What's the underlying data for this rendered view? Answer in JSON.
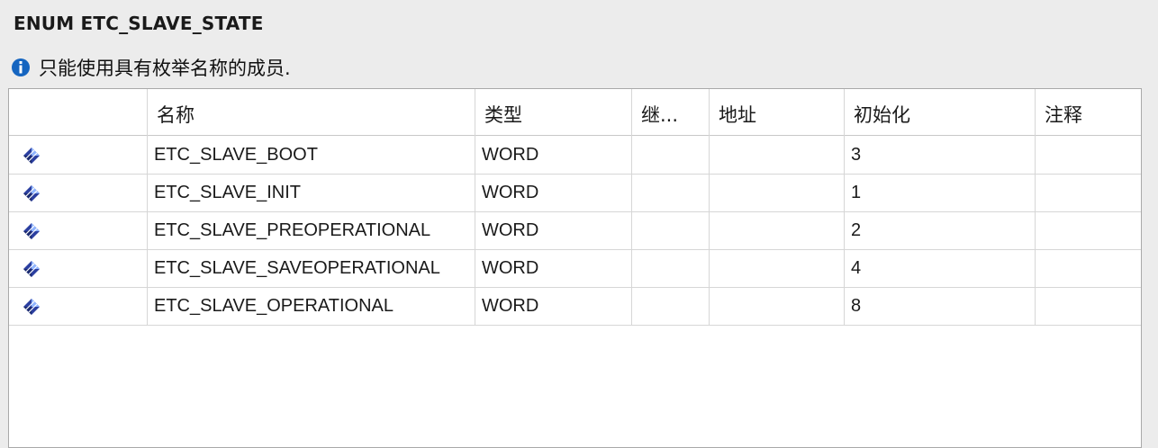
{
  "title": "ENUM  ETC_SLAVE_STATE",
  "info": {
    "icon": "info-icon",
    "text": "只能使用具有枚举名称的成员."
  },
  "table": {
    "columns": [
      "",
      "名称",
      "类型",
      "继...",
      "地址",
      "初始化",
      "注释"
    ],
    "rows": [
      {
        "icon": "enum-member-icon",
        "name": "ETC_SLAVE_BOOT",
        "type": "WORD",
        "inherit": "",
        "address": "",
        "init": "3",
        "comment": ""
      },
      {
        "icon": "enum-member-icon",
        "name": "ETC_SLAVE_INIT",
        "type": "WORD",
        "inherit": "",
        "address": "",
        "init": "1",
        "comment": ""
      },
      {
        "icon": "enum-member-icon",
        "name": "ETC_SLAVE_PREOPERATIONAL",
        "type": "WORD",
        "inherit": "",
        "address": "",
        "init": "2",
        "comment": ""
      },
      {
        "icon": "enum-member-icon",
        "name": "ETC_SLAVE_SAVEOPERATIONAL",
        "type": "WORD",
        "inherit": "",
        "address": "",
        "init": "4",
        "comment": ""
      },
      {
        "icon": "enum-member-icon",
        "name": "ETC_SLAVE_OPERATIONAL",
        "type": "WORD",
        "inherit": "",
        "address": "",
        "init": "8",
        "comment": ""
      }
    ]
  },
  "colors": {
    "background": "#ececec",
    "info_icon": "#1565c0",
    "grid": "#d6d6d6"
  }
}
